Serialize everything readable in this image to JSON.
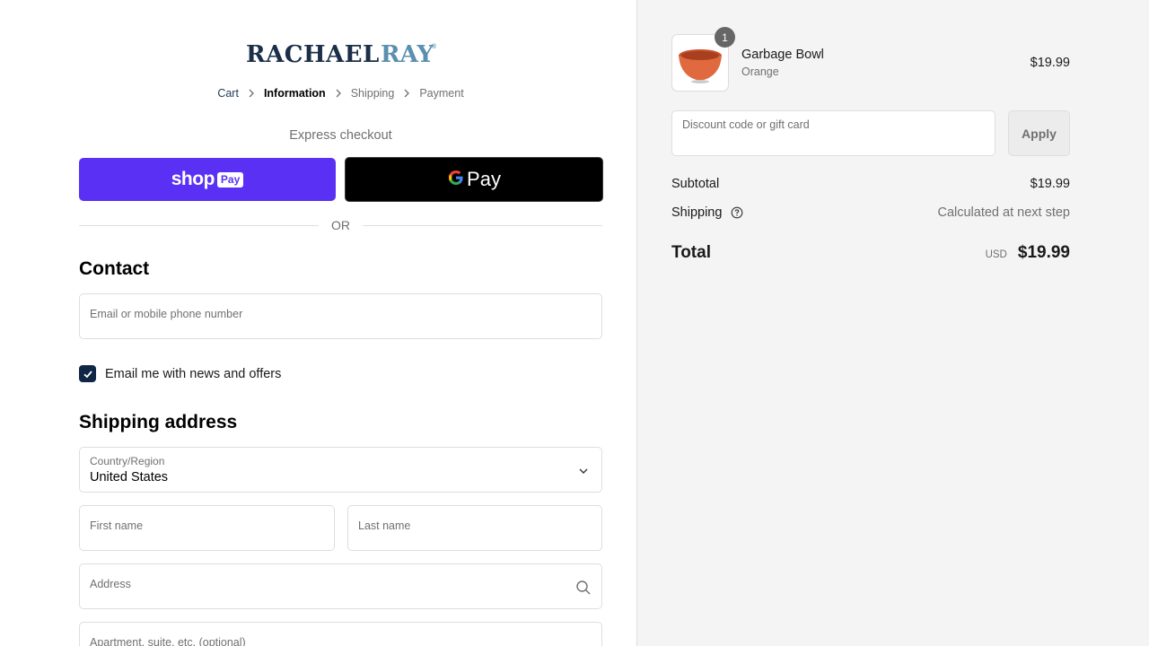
{
  "brand": {
    "logo_text_1": "RACHAEL",
    "logo_text_2": "RAY",
    "logo_mark": "®"
  },
  "breadcrumb": {
    "items": [
      {
        "label": "Cart"
      },
      {
        "label": "Information"
      },
      {
        "label": "Shipping"
      },
      {
        "label": "Payment"
      }
    ]
  },
  "express": {
    "label": "Express checkout",
    "shop_word": "shop",
    "shop_pay_box": "Pay",
    "gpay_g": "G",
    "gpay_label": "Pay",
    "or": "OR"
  },
  "contact": {
    "heading": "Contact",
    "email_placeholder": "Email or mobile phone number",
    "newsletter_label": "Email me with news and offers",
    "newsletter_checked": true
  },
  "shipping": {
    "heading": "Shipping address",
    "country_label": "Country/Region",
    "country_value": "United States",
    "first_name_placeholder": "First name",
    "last_name_placeholder": "Last name",
    "address_placeholder": "Address",
    "apartment_placeholder": "Apartment, suite, etc. (optional)"
  },
  "summary": {
    "item": {
      "name": "Garbage Bowl",
      "variant": "Orange",
      "price": "$19.99",
      "quantity": "1"
    },
    "discount_placeholder": "Discount code or gift card",
    "apply_label": "Apply",
    "subtotal_label": "Subtotal",
    "subtotal_value": "$19.99",
    "shipping_label": "Shipping",
    "shipping_value": "Calculated at next step",
    "total_label": "Total",
    "total_currency": "USD",
    "total_value": "$19.99"
  },
  "colors": {
    "shop_pay": "#5a31f4",
    "navy": "#0f2744",
    "logo_blue": "#5b8fb0",
    "logo_navy": "#1b2e4a"
  }
}
